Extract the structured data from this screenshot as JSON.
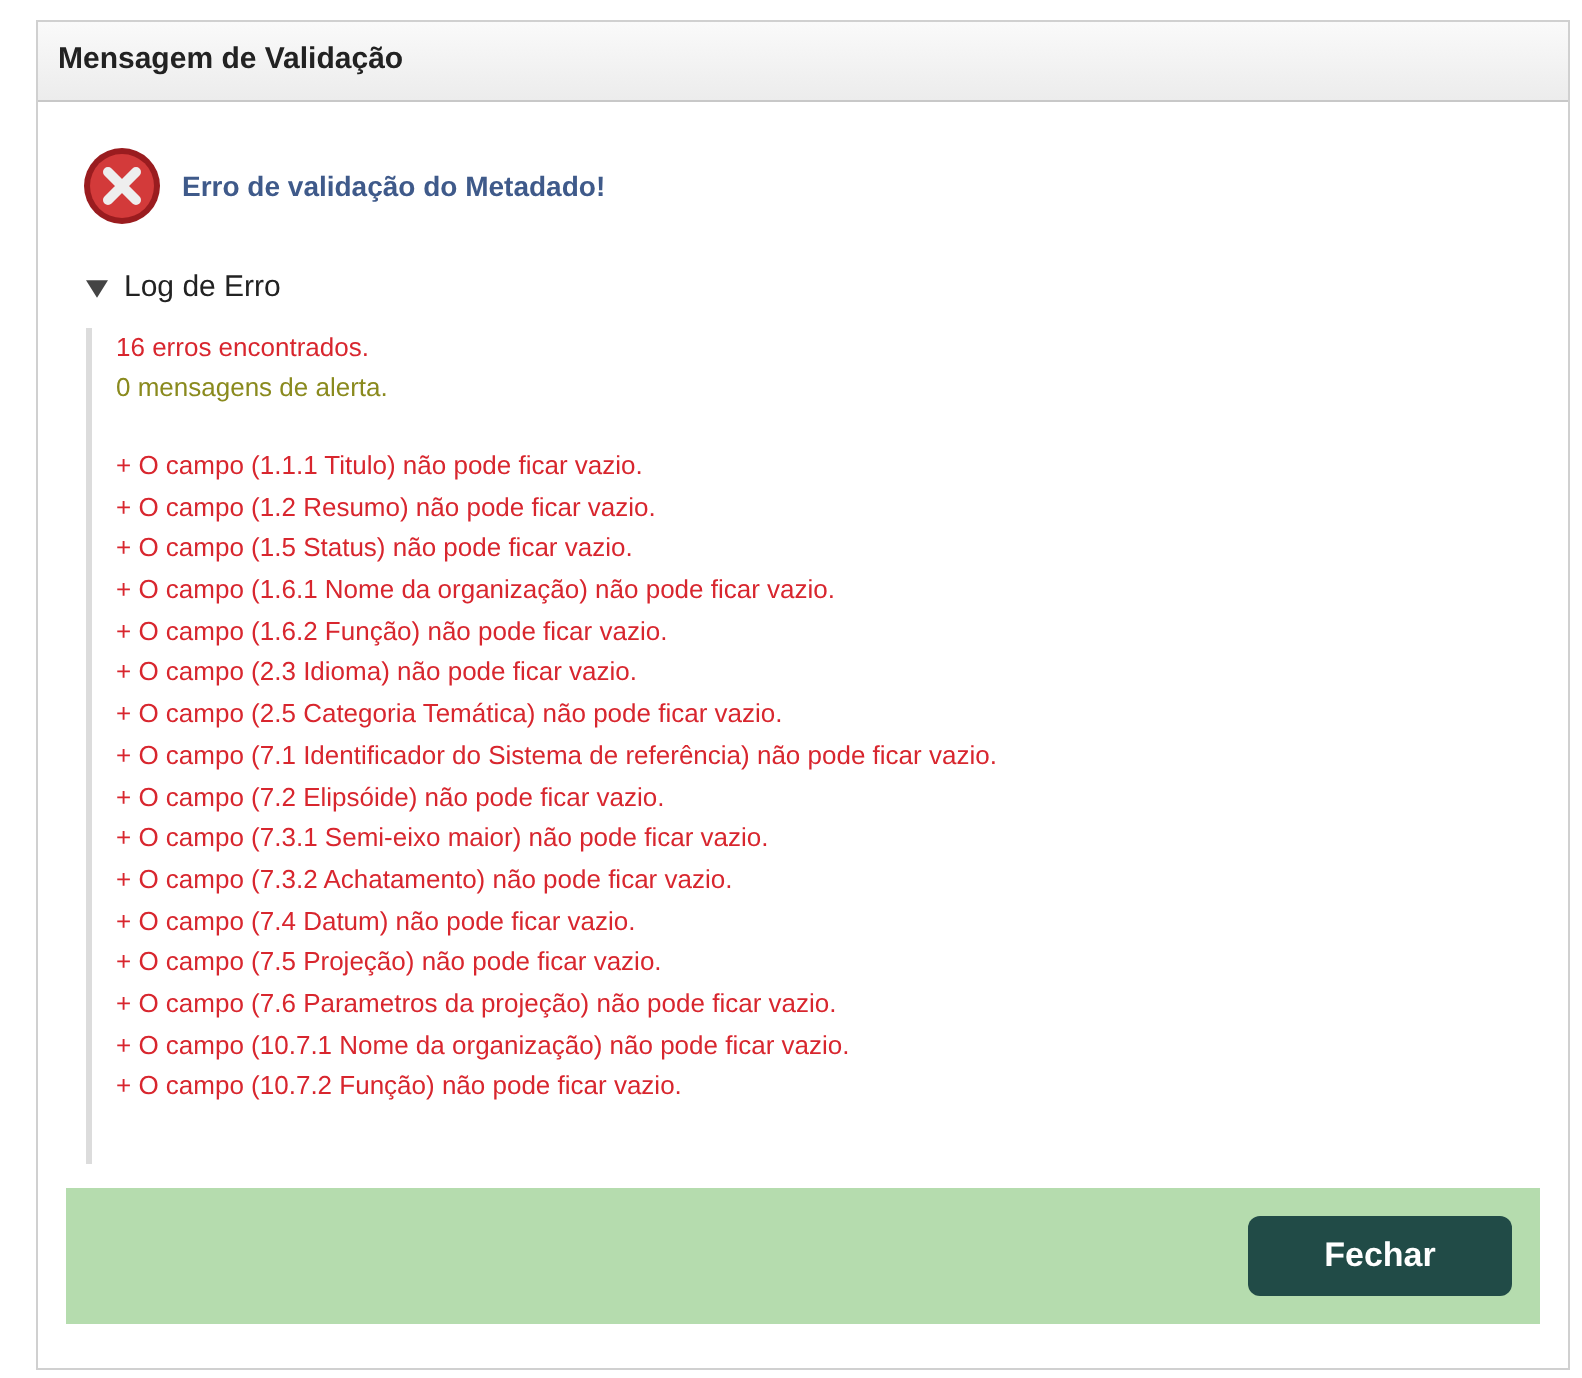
{
  "dialog": {
    "title": "Mensagem de Validação"
  },
  "alert": {
    "kind": "error",
    "message": "Erro de validação do Metadado!"
  },
  "log": {
    "title": "Log de Erro",
    "expanded": true,
    "summary": [
      {
        "kind": "error",
        "text": "16 erros encontrados."
      },
      {
        "kind": "warning",
        "text": "0 mensagens de alerta."
      }
    ],
    "errors": [
      "+ O campo (1.1.1 Titulo) não pode ficar vazio.",
      "+ O campo (1.2 Resumo) não pode ficar vazio.",
      "+ O campo (1.5 Status) não pode ficar vazio.",
      "+ O campo (1.6.1 Nome da organização) não pode ficar vazio.",
      "+ O campo (1.6.2 Função) não pode ficar vazio.",
      "+ O campo (2.3 Idioma) não pode ficar vazio.",
      "+ O campo (2.5 Categoria Temática) não pode ficar vazio.",
      "+ O campo (7.1 Identificador do Sistema de referência) não pode ficar vazio.",
      "+ O campo (7.2 Elipsóide) não pode ficar vazio.",
      "+ O campo (7.3.1 Semi-eixo maior) não pode ficar vazio.",
      "+ O campo (7.3.2 Achatamento) não pode ficar vazio.",
      "+ O campo (7.4 Datum) não pode ficar vazio.",
      "+ O campo (7.5 Projeção) não pode ficar vazio.",
      "+ O campo (7.6 Parametros da projeção) não pode ficar vazio.",
      "+ O campo (10.7.1 Nome da organização) não pode ficar vazio.",
      "+ O campo (10.7.2 Função) não pode ficar vazio."
    ]
  },
  "buttons": [
    "Fechar"
  ]
}
